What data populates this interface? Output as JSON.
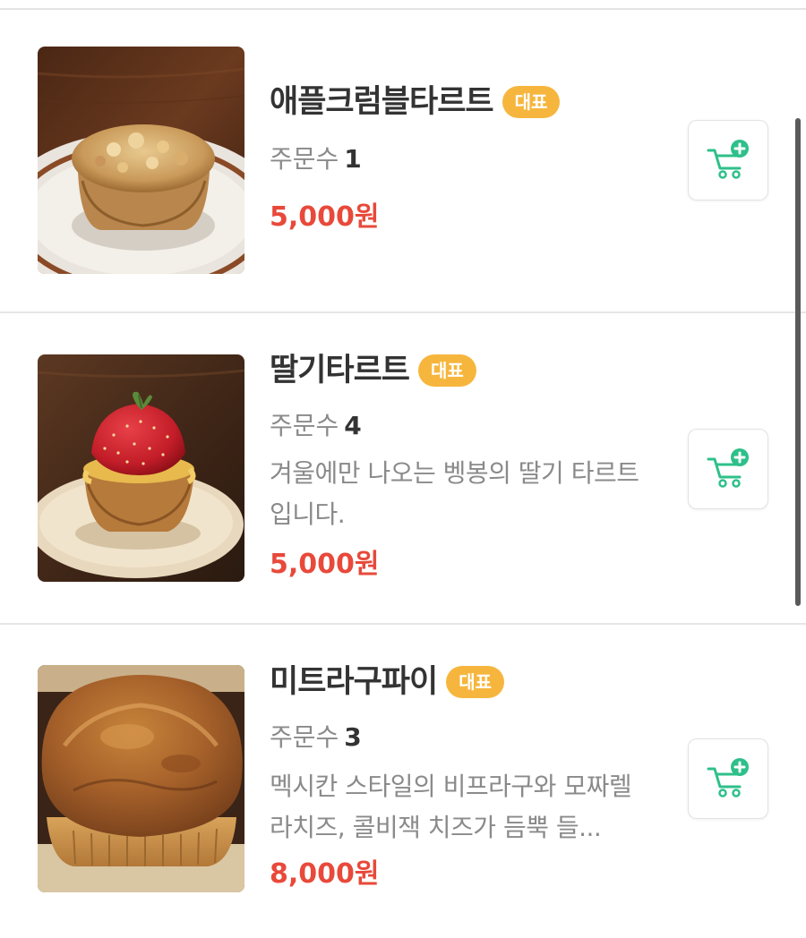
{
  "menu": {
    "order_label": "주문수",
    "items": [
      {
        "name": "애플크럼블타르트",
        "badge": "대표",
        "order_count": "1",
        "description": "",
        "price": "5,000원",
        "image": "apple-crumble-tart-photo"
      },
      {
        "name": "딸기타르트",
        "badge": "대표",
        "order_count": "4",
        "description": "겨울에만 나오는 벵봉의 딸기 타르트 입니다.",
        "price": "5,000원",
        "image": "strawberry-tart-photo"
      },
      {
        "name": "미트라구파이",
        "badge": "대표",
        "order_count": "3",
        "description": "멕시칸 스타일의 비프라구와 모짜렐라치즈, 콜비잭 치즈가 듬뿍 들...",
        "price": "8,000원",
        "image": "meat-ragu-pie-photo"
      }
    ]
  },
  "icons": {
    "cart_add": "cart-plus-icon"
  },
  "colors": {
    "badge": "#f6b63d",
    "price": "#e8493a",
    "cart_icon": "#2ec08a"
  }
}
